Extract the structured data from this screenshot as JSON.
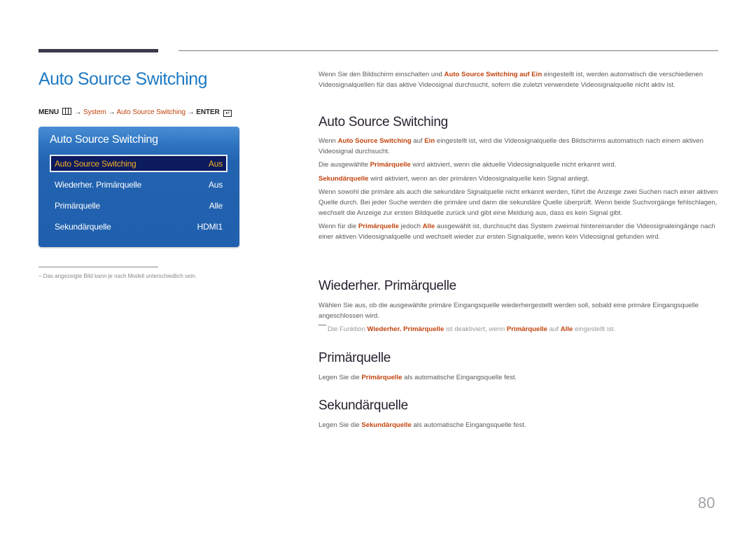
{
  "page_title": "Auto Source Switching",
  "menu_path": {
    "menu": "MENU",
    "menu_icon": "menu-grid-icon",
    "arrow": "→",
    "system": "System",
    "item": "Auto Source Switching",
    "enter": "ENTER",
    "enter_icon": "enter-icon"
  },
  "osd": {
    "title": "Auto Source Switching",
    "rows": [
      {
        "label": "Auto Source Switching",
        "value": "Aus",
        "selected": true
      },
      {
        "label": "Wiederher. Primärquelle",
        "value": "Aus",
        "selected": false
      },
      {
        "label": "Primärquelle",
        "value": "Alle",
        "selected": false
      },
      {
        "label": "Sekundärquelle",
        "value": "HDMI1",
        "selected": false
      }
    ],
    "colors": {
      "panel": "#2263b0",
      "selected_bg": "#0c1a5e",
      "selected_text": "#f5b025"
    }
  },
  "footnote": "Das angezeigte Bild kann je nach Modell unterschiedlich sein.",
  "intro": {
    "pre": "Wenn Sie den Bildschirm einschalten und ",
    "bold": "Auto Source Switching auf Ein",
    "post": " eingestellt ist, werden automatisch die verschiedenen Videosignalquellen für das aktive Videosignal durchsucht, sofern die zuletzt verwendete Videosignalquelle nicht aktiv ist."
  },
  "sections": {
    "ass": {
      "heading": "Auto Source Switching",
      "p1": {
        "a": "Wenn ",
        "b1": "Auto Source Switching",
        "c": " auf ",
        "b2": "Ein",
        "d": " eingestellt ist, wird die Videosignalquelle des Bildschirms automatisch nach einem aktiven Videosignal durchsucht."
      },
      "p2": {
        "a": "Die ausgewählte ",
        "b1": "Primärquelle",
        "c": " wird aktiviert, wenn die aktuelle Videosignalquelle nicht erkannt wird."
      },
      "p3": {
        "b1": "Sekundärquelle",
        "c": " wird aktiviert, wenn an der primären Videosignalquelle kein Signal anliegt."
      },
      "p4": "Wenn sowohl die primäre als auch die sekundäre Signalquelle nicht erkannt werden, führt die Anzeige zwei Suchen nach einer aktiven Quelle durch. Bei jeder Suche werden die primäre und dann die sekundäre Quelle überprüft.  Wenn beide Suchvorgänge fehlschlagen, wechselt die Anzeige zur ersten Bildquelle zurück und gibt eine Meldung aus, dass es kein Signal gibt.",
      "p5": {
        "a": "Wenn für die ",
        "b1": "Primärquelle",
        "c": " jedoch ",
        "b2": "Alle",
        "d": " ausgewählt ist, durchsucht das System zweimal hintereinander die Videosignaleingänge nach einer aktiven Videosignalquelle und wechselt wieder zur ersten Signalquelle, wenn kein Videosignal gefunden wird."
      }
    },
    "wiederher": {
      "heading": "Wiederher. Primärquelle",
      "p1": "Wählen Sie aus, ob die ausgewählte primäre Eingangsquelle wiederhergestellt werden soll, sobald eine primäre Eingangsquelle angeschlossen wird.",
      "note": {
        "a": "Die Funktion ",
        "b1": "Wiederher. Primärquelle",
        "c": " ist deaktiviert, wenn ",
        "b2": "Primärquelle",
        "d": " auf ",
        "b3": "Alle",
        "e": " eingestellt ist."
      }
    },
    "primaer": {
      "heading": "Primärquelle",
      "p1": {
        "a": "Legen Sie die ",
        "b1": "Primärquelle",
        "c": " als automatische Eingangsquelle fest."
      }
    },
    "sekundaer": {
      "heading": "Sekundärquelle",
      "p1": {
        "a": "Legen Sie die ",
        "b1": "Sekundärquelle",
        "c": " als automatische Eingangsquelle fest."
      }
    }
  },
  "page_number": "80",
  "colors": {
    "title_blue": "#1f7ac3",
    "highlight_red": "#c1440e"
  }
}
